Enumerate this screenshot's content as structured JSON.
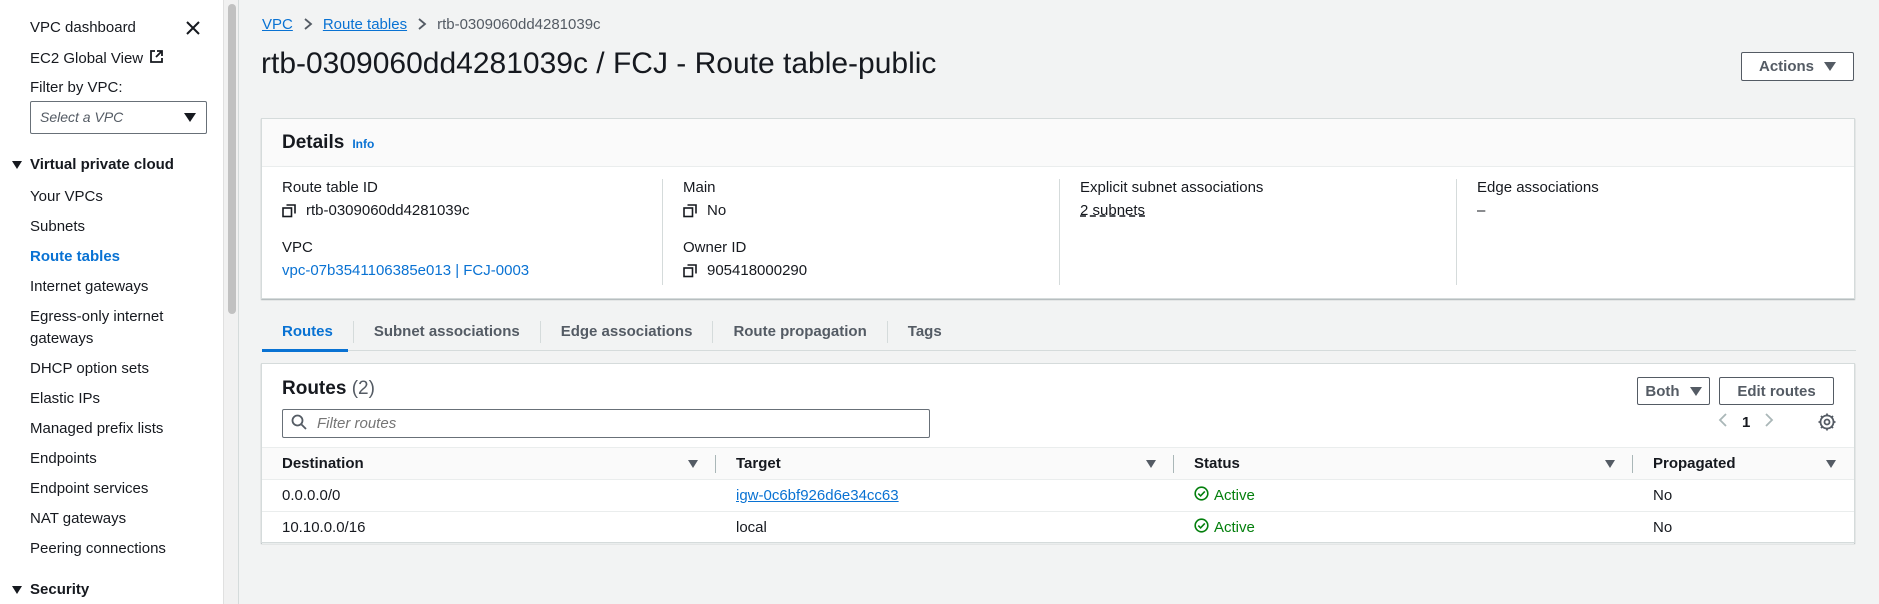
{
  "sidebar": {
    "dashboard_label": "VPC dashboard",
    "ec2_global_view_label": "EC2 Global View",
    "filter_label": "Filter by VPC:",
    "vpc_select_placeholder": "Select a VPC",
    "section_vpc": "Virtual private cloud",
    "items": [
      {
        "label": "Your VPCs"
      },
      {
        "label": "Subnets"
      },
      {
        "label": "Route tables"
      },
      {
        "label": "Internet gateways"
      },
      {
        "label": "Egress-only internet gateways"
      },
      {
        "label": "DHCP option sets"
      },
      {
        "label": "Elastic IPs"
      },
      {
        "label": "Managed prefix lists"
      },
      {
        "label": "Endpoints"
      },
      {
        "label": "Endpoint services"
      },
      {
        "label": "NAT gateways"
      },
      {
        "label": "Peering connections"
      }
    ],
    "active_item": "Route tables",
    "section_security": "Security"
  },
  "breadcrumb": {
    "root": "VPC",
    "parent": "Route tables",
    "current": "rtb-0309060dd4281039c"
  },
  "page_title": "rtb-0309060dd4281039c / FCJ - Route table-public",
  "actions_label": "Actions",
  "details": {
    "title": "Details",
    "info_label": "Info",
    "route_table_id_label": "Route table ID",
    "route_table_id": "rtb-0309060dd4281039c",
    "vpc_label": "VPC",
    "vpc_value": "vpc-07b3541106385e013 | FCJ-0003",
    "main_label": "Main",
    "main_value": "No",
    "owner_id_label": "Owner ID",
    "owner_id": "905418000290",
    "explicit_label": "Explicit subnet associations",
    "explicit_value": "2 subnets",
    "edge_label": "Edge associations",
    "edge_value": "–"
  },
  "tabs": [
    {
      "label": "Routes"
    },
    {
      "label": "Subnet associations"
    },
    {
      "label": "Edge associations"
    },
    {
      "label": "Route propagation"
    },
    {
      "label": "Tags"
    }
  ],
  "routes": {
    "title": "Routes",
    "count": "(2)",
    "both_label": "Both",
    "edit_label": "Edit routes",
    "filter_placeholder": "Filter routes",
    "page_number": "1",
    "columns": [
      "Destination",
      "Target",
      "Status",
      "Propagated"
    ],
    "rows": [
      {
        "destination": "0.0.0.0/0",
        "target": "igw-0c6bf926d6e34cc63",
        "status": "Active",
        "propagated": "No"
      },
      {
        "destination": "10.10.0.0/16",
        "target": "local",
        "status": "Active",
        "propagated": "No"
      }
    ]
  },
  "colors": {
    "link": "#0972d3",
    "success": "#037f0c",
    "text": "#16191f",
    "muted": "#545b64"
  }
}
